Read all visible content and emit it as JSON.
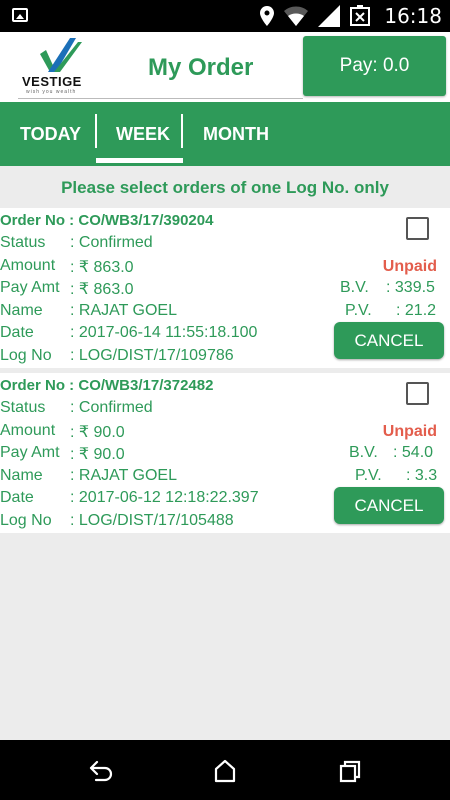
{
  "status_bar": {
    "time": "16:18"
  },
  "header": {
    "logo_brand": "VESTIGE",
    "logo_tagline": "wish you wealth",
    "title": "My Order",
    "pay_button": "Pay: 0.0"
  },
  "tabs": [
    {
      "label": "TODAY"
    },
    {
      "label": "WEEK"
    },
    {
      "label": "MONTH"
    }
  ],
  "instruction": "Please select orders of one Log No. only",
  "labels": {
    "order_no": "Order No :",
    "status": "Status",
    "amount": "Amount",
    "pay_amt": "Pay Amt",
    "name": "Name",
    "date": "Date",
    "log_no": "Log No",
    "bv": "B.V.",
    "pv": "P.V.",
    "cancel": "CANCEL"
  },
  "orders": [
    {
      "order_no": "CO/WB3/17/390204",
      "status": ": Confirmed",
      "amount": ": ₹ 863.0",
      "pay_amt": ": ₹ 863.0",
      "name": ": RAJAT GOEL",
      "date": ": 2017-06-14 11:55:18.100",
      "log_no": ": LOG/DIST/17/109786",
      "payment_status": "Unpaid",
      "bv": ": 339.5",
      "pv": ": 21.2"
    },
    {
      "order_no": "CO/WB3/17/372482",
      "status": ": Confirmed",
      "amount": ": ₹ 90.0",
      "pay_amt": ": ₹ 90.0",
      "name": ": RAJAT GOEL",
      "date": ": 2017-06-12 12:18:22.397",
      "log_no": ": LOG/DIST/17/105488",
      "payment_status": "Unpaid",
      "bv": ": 54.0",
      "pv": ": 3.3"
    }
  ],
  "colors": {
    "brand_green": "#2e9a59",
    "unpaid_red": "#e35d4c",
    "background": "#ececec"
  }
}
